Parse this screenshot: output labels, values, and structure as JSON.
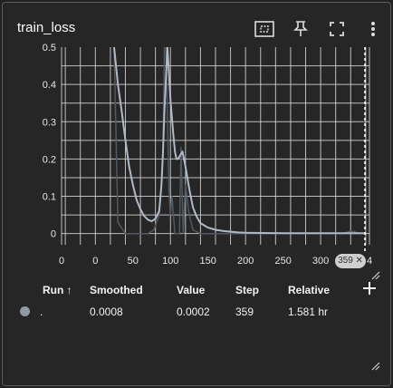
{
  "card": {
    "title": "train_loss"
  },
  "toolbar": {
    "icons": [
      "fit-domain-icon",
      "pin-icon",
      "fullscreen-icon",
      "more-vert-icon"
    ]
  },
  "chart_data": {
    "type": "line",
    "title": "",
    "xlabel": "",
    "ylabel": "",
    "x_ticks": [
      "0",
      "0",
      "50",
      "100",
      "150",
      "200",
      "250",
      "300",
      "4"
    ],
    "y_ticks": [
      "0",
      "0.1",
      "0.2",
      "0.3",
      "0.4",
      "0.5"
    ],
    "xlim": [
      -45,
      365
    ],
    "ylim": [
      -0.03,
      0.5
    ],
    "grid": true,
    "hover_step": 359,
    "hover_step_label": "359 ✕",
    "series": [
      {
        "kind": "raw",
        "color": "#52585f",
        "x": [
          25,
          30,
          40,
          50,
          60,
          70,
          78,
          85,
          90,
          92,
          94,
          98,
          100,
          102,
          106,
          110,
          112,
          114,
          117,
          120,
          125,
          130,
          140,
          150,
          160,
          200,
          250,
          300,
          330,
          340,
          345,
          350,
          359
        ],
        "y": [
          0.5,
          0.03,
          0.0,
          0.0,
          0.0,
          0.0,
          0.01,
          0.05,
          0.2,
          0.5,
          0.5,
          0.12,
          0.05,
          0.1,
          0.0,
          0.0,
          0.0,
          0.23,
          0.0,
          0.13,
          0.05,
          0.01,
          0.0,
          0.0,
          0.0,
          0.0,
          0.0,
          0.0,
          0.0,
          0.007,
          0.005,
          0.0,
          0.0002
        ]
      },
      {
        "kind": "smoothed",
        "color": "#b0bac5",
        "x": [
          25,
          30,
          35,
          40,
          45,
          50,
          55,
          60,
          65,
          70,
          75,
          80,
          85,
          88,
          90,
          92,
          94,
          96,
          98,
          100,
          102,
          104,
          106,
          108,
          110,
          113,
          116,
          120,
          125,
          130,
          135,
          140,
          150,
          160,
          170,
          180,
          190,
          200,
          220,
          250,
          300,
          330,
          359
        ],
        "y": [
          0.5,
          0.4,
          0.33,
          0.25,
          0.18,
          0.13,
          0.09,
          0.065,
          0.047,
          0.037,
          0.033,
          0.04,
          0.06,
          0.13,
          0.22,
          0.33,
          0.42,
          0.5,
          0.43,
          0.36,
          0.31,
          0.26,
          0.22,
          0.2,
          0.2,
          0.21,
          0.22,
          0.18,
          0.12,
          0.07,
          0.045,
          0.028,
          0.016,
          0.01,
          0.007,
          0.005,
          0.003,
          0.002,
          0.0015,
          0.001,
          0.0009,
          0.0009,
          0.0008
        ]
      }
    ]
  },
  "table": {
    "headers": {
      "run": "Run ↑",
      "smoothed": "Smoothed",
      "value": "Value",
      "step": "Step",
      "relative": "Relative"
    },
    "rows": [
      {
        "color": "#8f9aa7",
        "run": ".",
        "smoothed": "0.0008",
        "value": "0.0002",
        "step": "359",
        "relative": "1.581 hr"
      }
    ]
  }
}
